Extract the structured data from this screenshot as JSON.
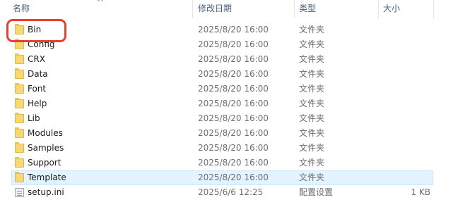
{
  "header": {
    "name": "名称",
    "date_modified": "修改日期",
    "type": "类型",
    "size": "大小",
    "sort_glyph": "^"
  },
  "files": [
    {
      "name": "Bin",
      "date": "2025/8/20 16:00",
      "type": "文件夹",
      "size": "",
      "icon": "folder-icon",
      "highlighted": true
    },
    {
      "name": "Config",
      "date": "2025/8/20 16:00",
      "type": "文件夹",
      "size": "",
      "icon": "folder-icon"
    },
    {
      "name": "CRX",
      "date": "2025/8/20 16:00",
      "type": "文件夹",
      "size": "",
      "icon": "folder-icon"
    },
    {
      "name": "Data",
      "date": "2025/8/20 16:00",
      "type": "文件夹",
      "size": "",
      "icon": "folder-icon"
    },
    {
      "name": "Font",
      "date": "2025/8/20 16:00",
      "type": "文件夹",
      "size": "",
      "icon": "folder-icon"
    },
    {
      "name": "Help",
      "date": "2025/8/20 16:00",
      "type": "文件夹",
      "size": "",
      "icon": "folder-icon"
    },
    {
      "name": "Lib",
      "date": "2025/8/20 16:00",
      "type": "文件夹",
      "size": "",
      "icon": "folder-icon"
    },
    {
      "name": "Modules",
      "date": "2025/8/20 16:00",
      "type": "文件夹",
      "size": "",
      "icon": "folder-icon"
    },
    {
      "name": "Samples",
      "date": "2025/8/20 16:00",
      "type": "文件夹",
      "size": "",
      "icon": "folder-icon"
    },
    {
      "name": "Support",
      "date": "2025/8/20 16:00",
      "type": "文件夹",
      "size": "",
      "icon": "folder-icon"
    },
    {
      "name": "Template",
      "date": "2025/8/20 16:00",
      "type": "文件夹",
      "size": "",
      "icon": "folder-icon",
      "hovered": true
    },
    {
      "name": "setup.ini",
      "date": "2025/6/6 12:25",
      "type": "配置设置",
      "size": "1 KB",
      "icon": "ini-file-icon"
    }
  ],
  "colors": {
    "highlight_border": "#e8402c",
    "hover_background": "#e5f3ff",
    "folder": "#f8d775"
  }
}
